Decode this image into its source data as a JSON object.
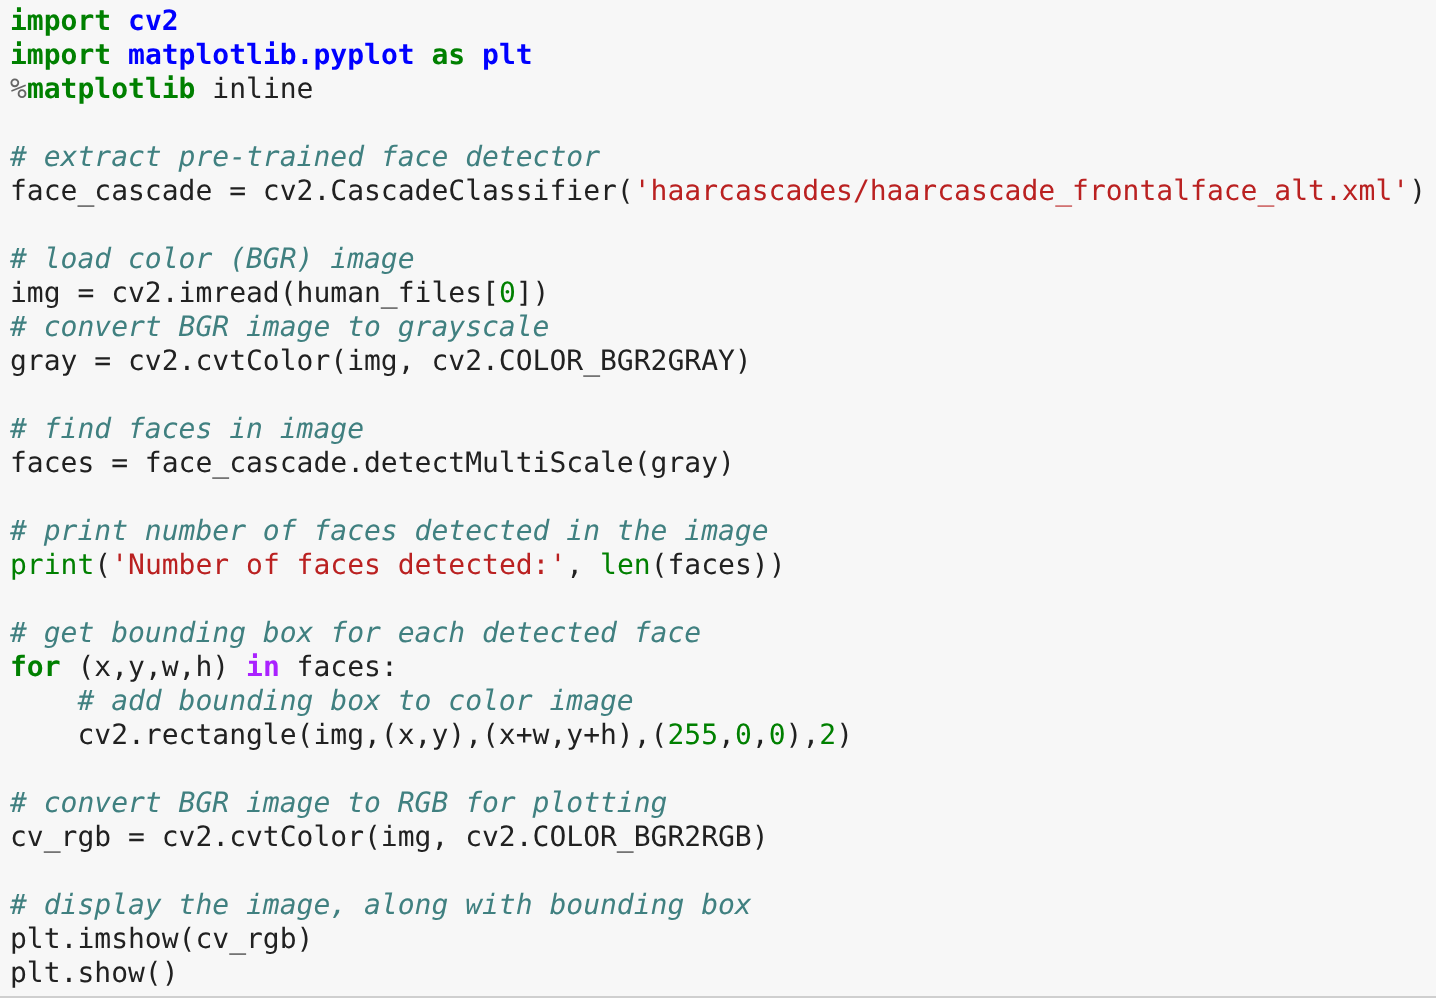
{
  "code_cell": {
    "blocks": [
      {
        "lines": [
          [
            {
              "kind": "keyword",
              "text": "import "
            },
            {
              "kind": "module",
              "text": "cv2"
            }
          ],
          [
            {
              "kind": "keyword",
              "text": "import "
            },
            {
              "kind": "module",
              "text": "matplotlib.pyplot "
            },
            {
              "kind": "keyword",
              "text": "as "
            },
            {
              "kind": "module",
              "text": "plt"
            }
          ],
          [
            {
              "kind": "operator",
              "text": "%"
            },
            {
              "kind": "keyword",
              "text": "matplotlib"
            },
            {
              "kind": "plain",
              "text": " inline"
            }
          ]
        ]
      },
      {
        "lines": [
          [
            {
              "kind": "comment",
              "text": "# extract pre-trained face detector"
            }
          ],
          [
            {
              "kind": "plain",
              "text": "face_cascade = cv2.CascadeClassifier("
            },
            {
              "kind": "string",
              "text": "'haarcascades/haarcascade_frontalface_alt.xml'"
            },
            {
              "kind": "plain",
              "text": ")"
            }
          ]
        ]
      },
      {
        "lines": [
          [
            {
              "kind": "comment",
              "text": "# load color (BGR) image"
            }
          ],
          [
            {
              "kind": "plain",
              "text": "img = cv2.imread(human_files["
            },
            {
              "kind": "number",
              "text": "0"
            },
            {
              "kind": "plain",
              "text": "])"
            }
          ],
          [
            {
              "kind": "comment",
              "text": "# convert BGR image to grayscale"
            }
          ],
          [
            {
              "kind": "plain",
              "text": "gray = cv2.cvtColor(img, cv2.COLOR_BGR2GRAY)"
            }
          ]
        ]
      },
      {
        "lines": [
          [
            {
              "kind": "comment",
              "text": "# find faces in image"
            }
          ],
          [
            {
              "kind": "plain",
              "text": "faces = face_cascade.detectMultiScale(gray)"
            }
          ]
        ]
      },
      {
        "lines": [
          [
            {
              "kind": "comment",
              "text": "# print number of faces detected in the image"
            }
          ],
          [
            {
              "kind": "builtin",
              "text": "print"
            },
            {
              "kind": "plain",
              "text": "("
            },
            {
              "kind": "string",
              "text": "'Number of faces detected:'"
            },
            {
              "kind": "plain",
              "text": ", "
            },
            {
              "kind": "builtin",
              "text": "len"
            },
            {
              "kind": "plain",
              "text": "(faces))"
            }
          ]
        ]
      },
      {
        "lines": [
          [
            {
              "kind": "comment",
              "text": "# get bounding box for each detected face"
            }
          ],
          [
            {
              "kind": "keyword",
              "text": "for"
            },
            {
              "kind": "plain",
              "text": " (x,y,w,h) "
            },
            {
              "kind": "operator_word",
              "text": "in"
            },
            {
              "kind": "plain",
              "text": " faces:"
            }
          ],
          [
            {
              "kind": "comment",
              "text": "    # add bounding box to color image"
            }
          ],
          [
            {
              "kind": "plain",
              "text": "    cv2.rectangle(img,(x,y),(x+w,y+h),("
            },
            {
              "kind": "number",
              "text": "255"
            },
            {
              "kind": "plain",
              "text": ","
            },
            {
              "kind": "number",
              "text": "0"
            },
            {
              "kind": "plain",
              "text": ","
            },
            {
              "kind": "number",
              "text": "0"
            },
            {
              "kind": "plain",
              "text": "),"
            },
            {
              "kind": "number",
              "text": "2"
            },
            {
              "kind": "plain",
              "text": ")"
            }
          ]
        ]
      },
      {
        "lines": [
          [
            {
              "kind": "comment",
              "text": "# convert BGR image to RGB for plotting"
            }
          ],
          [
            {
              "kind": "plain",
              "text": "cv_rgb = cv2.cvtColor(img, cv2.COLOR_BGR2RGB)"
            }
          ]
        ]
      },
      {
        "lines": [
          [
            {
              "kind": "comment",
              "text": "# display the image, along with bounding box"
            }
          ],
          [
            {
              "kind": "plain",
              "text": "plt.imshow(cv_rgb)"
            }
          ],
          [
            {
              "kind": "plain",
              "text": "plt.show()"
            }
          ]
        ]
      }
    ]
  }
}
